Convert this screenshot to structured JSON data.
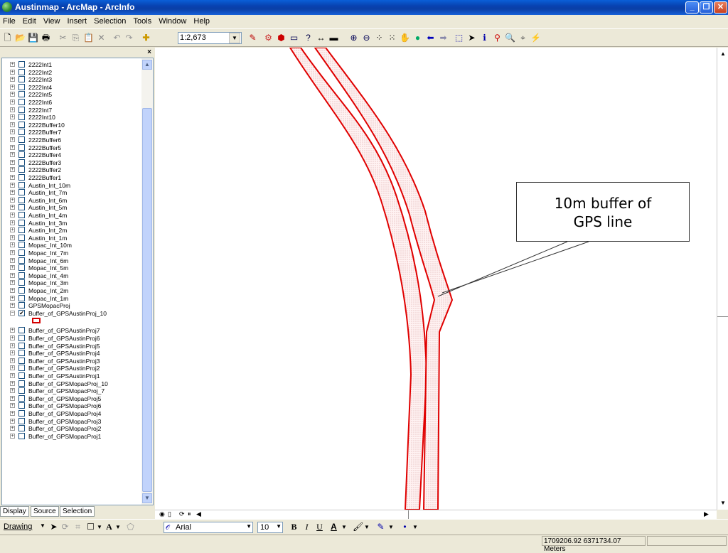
{
  "window": {
    "title": "Austinmap - ArcMap - ArcInfo"
  },
  "menu": [
    "File",
    "Edit",
    "View",
    "Insert",
    "Selection",
    "Tools",
    "Window",
    "Help"
  ],
  "toolbar": {
    "scale": "1:2,673",
    "icons": [
      "new-document-icon",
      "open-folder-icon",
      "save-icon",
      "print-icon",
      "cut-icon",
      "copy-icon",
      "paste-icon",
      "delete-icon",
      "undo-icon",
      "redo-icon",
      "add-data-icon",
      "scale-dropdown",
      "editor-icon",
      "arctoolbox-icon",
      "arccatalog-icon",
      "window-icon",
      "whats-this-icon",
      "measure-icon",
      "zoom-in-icon",
      "zoom-out-icon",
      "fixed-zoom-in-icon",
      "fixed-zoom-out-icon",
      "pan-icon",
      "full-extent-icon",
      "back-icon",
      "forward-icon",
      "select-features-icon",
      "pointer-icon",
      "identify-icon",
      "hyperlink-icon",
      "find-icon",
      "go-to-xy-icon",
      "lightning-icon"
    ]
  },
  "toc": {
    "layers": [
      {
        "name": "2222Int1",
        "checked": false,
        "expanded": false
      },
      {
        "name": "2222Int2",
        "checked": false,
        "expanded": false
      },
      {
        "name": "2222Int3",
        "checked": false,
        "expanded": false
      },
      {
        "name": "2222Int4",
        "checked": false,
        "expanded": false
      },
      {
        "name": "2222Int5",
        "checked": false,
        "expanded": false
      },
      {
        "name": "2222Int6",
        "checked": false,
        "expanded": false
      },
      {
        "name": "2222Int7",
        "checked": false,
        "expanded": false
      },
      {
        "name": "2222Int10",
        "checked": false,
        "expanded": false
      },
      {
        "name": "2222Buffer10",
        "checked": false,
        "expanded": false
      },
      {
        "name": "2222Buffer7",
        "checked": false,
        "expanded": false
      },
      {
        "name": "2222Buffer6",
        "checked": false,
        "expanded": false
      },
      {
        "name": "2222Buffer5",
        "checked": false,
        "expanded": false
      },
      {
        "name": "2222Buffer4",
        "checked": false,
        "expanded": false
      },
      {
        "name": "2222Buffer3",
        "checked": false,
        "expanded": false
      },
      {
        "name": "2222Buffer2",
        "checked": false,
        "expanded": false
      },
      {
        "name": "2222Buffer1",
        "checked": false,
        "expanded": false
      },
      {
        "name": "Austin_Int_10m",
        "checked": false,
        "expanded": false
      },
      {
        "name": "Austin_Int_7m",
        "checked": false,
        "expanded": false
      },
      {
        "name": "Austin_Int_6m",
        "checked": false,
        "expanded": false
      },
      {
        "name": "Austin_Int_5m",
        "checked": false,
        "expanded": false
      },
      {
        "name": "Austin_Int_4m",
        "checked": false,
        "expanded": false
      },
      {
        "name": "Austin_Int_3m",
        "checked": false,
        "expanded": false
      },
      {
        "name": "Austin_Int_2m",
        "checked": false,
        "expanded": false
      },
      {
        "name": "Austin_Int_1m",
        "checked": false,
        "expanded": false
      },
      {
        "name": "Mopac_Int_10m",
        "checked": false,
        "expanded": false
      },
      {
        "name": "Mopac_Int_7m",
        "checked": false,
        "expanded": false
      },
      {
        "name": "Mopac_Int_6m",
        "checked": false,
        "expanded": false
      },
      {
        "name": "Mopac_Int_5m",
        "checked": false,
        "expanded": false
      },
      {
        "name": "Mopac_Int_4m",
        "checked": false,
        "expanded": false
      },
      {
        "name": "Mopac_Int_3m",
        "checked": false,
        "expanded": false
      },
      {
        "name": "Mopac_Int_2m",
        "checked": false,
        "expanded": false
      },
      {
        "name": "Mopac_Int_1m",
        "checked": false,
        "expanded": false
      },
      {
        "name": "GPSMopacProj",
        "checked": false,
        "expanded": false
      },
      {
        "name": "Buffer_of_GPSAustinProj_10",
        "checked": true,
        "expanded": true
      },
      {
        "name": "Buffer_of_GPSAustinProj7",
        "checked": false,
        "expanded": false
      },
      {
        "name": "Buffer_of_GPSAustinProj6",
        "checked": false,
        "expanded": false
      },
      {
        "name": "Buffer_of_GPSAustinProj5",
        "checked": false,
        "expanded": false
      },
      {
        "name": "Buffer_of_GPSAustinProj4",
        "checked": false,
        "expanded": false
      },
      {
        "name": "Buffer_of_GPSAustinProj3",
        "checked": false,
        "expanded": false
      },
      {
        "name": "Buffer_of_GPSAustinProj2",
        "checked": false,
        "expanded": false
      },
      {
        "name": "Buffer_of_GPSAustinProj1",
        "checked": false,
        "expanded": false
      },
      {
        "name": "Buffer_of_GPSMopacProj_10",
        "checked": false,
        "expanded": false
      },
      {
        "name": "Buffer_of_GPSMopacProj_7",
        "checked": false,
        "expanded": false
      },
      {
        "name": "Buffer_of_GPSMopacProj5",
        "checked": false,
        "expanded": false
      },
      {
        "name": "Buffer_of_GPSMopacProj6",
        "checked": false,
        "expanded": false
      },
      {
        "name": "Buffer_of_GPSMopacProj4",
        "checked": false,
        "expanded": false
      },
      {
        "name": "Buffer_of_GPSMopacProj3",
        "checked": false,
        "expanded": false
      },
      {
        "name": "Buffer_of_GPSMopacProj2",
        "checked": false,
        "expanded": false
      },
      {
        "name": "Buffer_of_GPSMopacProj1",
        "checked": false,
        "expanded": false
      }
    ],
    "tabs": [
      "Display",
      "Source",
      "Selection"
    ],
    "symbol_color": "#d40000"
  },
  "map": {
    "callout_line1": "10m buffer of",
    "callout_line2": "GPS line",
    "buffer_stroke": "#e00000"
  },
  "drawing": {
    "label": "Drawing",
    "font": "Arial",
    "size": "10"
  },
  "status": {
    "coords": "1709206.92  6371734.07 Meters"
  }
}
